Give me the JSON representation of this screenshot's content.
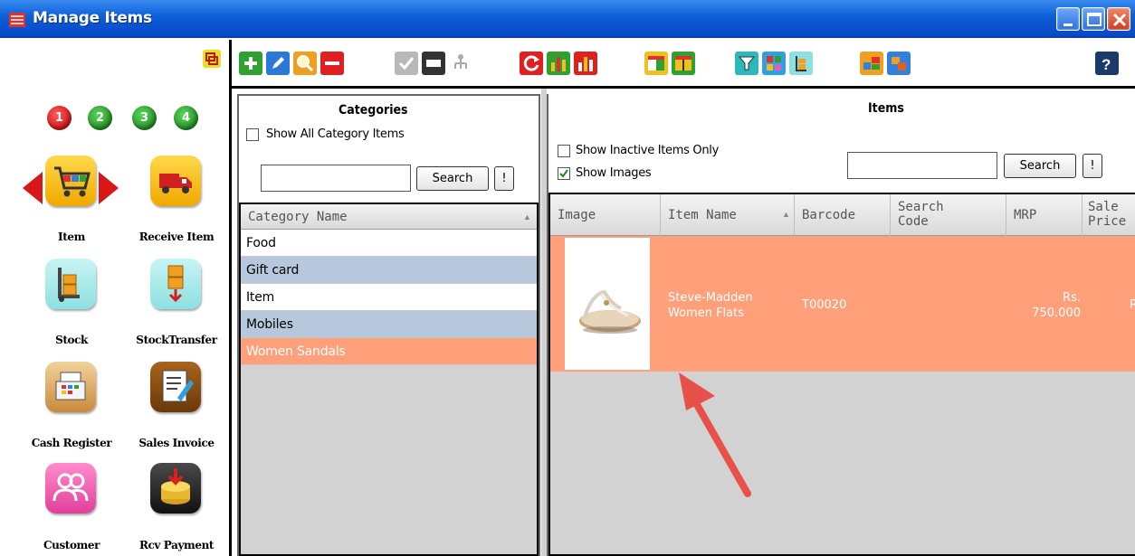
{
  "window": {
    "title": "Manage Items",
    "controls": [
      "minimize-icon",
      "maximize-icon",
      "close-icon"
    ]
  },
  "left_nav": {
    "steps": [
      "1",
      "2",
      "3",
      "4"
    ],
    "tiles": [
      {
        "label": "Item",
        "icon": "shopping-cart-icon"
      },
      {
        "label": "Receive Item",
        "icon": "delivery-truck-icon"
      },
      {
        "label": "Stock",
        "icon": "hand-truck-icon"
      },
      {
        "label": "StockTransfer",
        "icon": "stock-transfer-icon"
      },
      {
        "label": "Cash Register",
        "icon": "cash-register-icon"
      },
      {
        "label": "Sales Invoice",
        "icon": "sales-invoice-icon"
      },
      {
        "label": "Customer",
        "icon": "customers-icon"
      },
      {
        "label": "Rcv Payment",
        "icon": "receive-payment-icon"
      }
    ]
  },
  "toolbar": {
    "buttons": [
      "add-icon",
      "edit-icon",
      "search-icon",
      "delete-icon",
      "check-icon",
      "price-tag-icon",
      "tree-icon",
      "refresh-icon",
      "bar-chart-icon",
      "bar-chart-red-icon",
      "table-columns-icon",
      "table-header-icon",
      "filter-icon",
      "color-grid-icon",
      "stock-icon",
      "export-icon",
      "import-icon",
      "help-icon"
    ],
    "help_label": "?"
  },
  "categories": {
    "title": "Categories",
    "show_all_label": "Show All Category Items",
    "show_all_checked": false,
    "search_value": "",
    "search_button": "Search",
    "exclaim_button": "!",
    "column_header": "Category Name",
    "rows": [
      {
        "name": "Food",
        "style": "white"
      },
      {
        "name": "Gift card",
        "style": "blue"
      },
      {
        "name": "Item",
        "style": "white"
      },
      {
        "name": "Mobiles",
        "style": "blue"
      },
      {
        "name": "Women Sandals",
        "style": "selected"
      }
    ]
  },
  "items": {
    "title": "Items",
    "inactive_label": "Show Inactive Items Only",
    "inactive_checked": false,
    "images_label": "Show Images",
    "images_checked": true,
    "search_value": "",
    "search_button": "Search",
    "exclaim_button": "!",
    "columns": [
      "Image",
      "Item Name",
      "Barcode",
      "Search Code",
      "MRP",
      "Sale Price"
    ],
    "rows": [
      {
        "image": "sandal-image",
        "item_name": "Steve-Madden Women Flats",
        "barcode": "T00020",
        "search_code": "",
        "mrp": "Rs. 750.000",
        "sale_price": "R"
      }
    ]
  },
  "colors": {
    "selected_row": "#ffa07a",
    "alt_row": "#b8c8dc",
    "grid_background": "#d2d2d2",
    "titlebar": "#0c5fd8",
    "annotation_arrow": "#e8504a"
  }
}
